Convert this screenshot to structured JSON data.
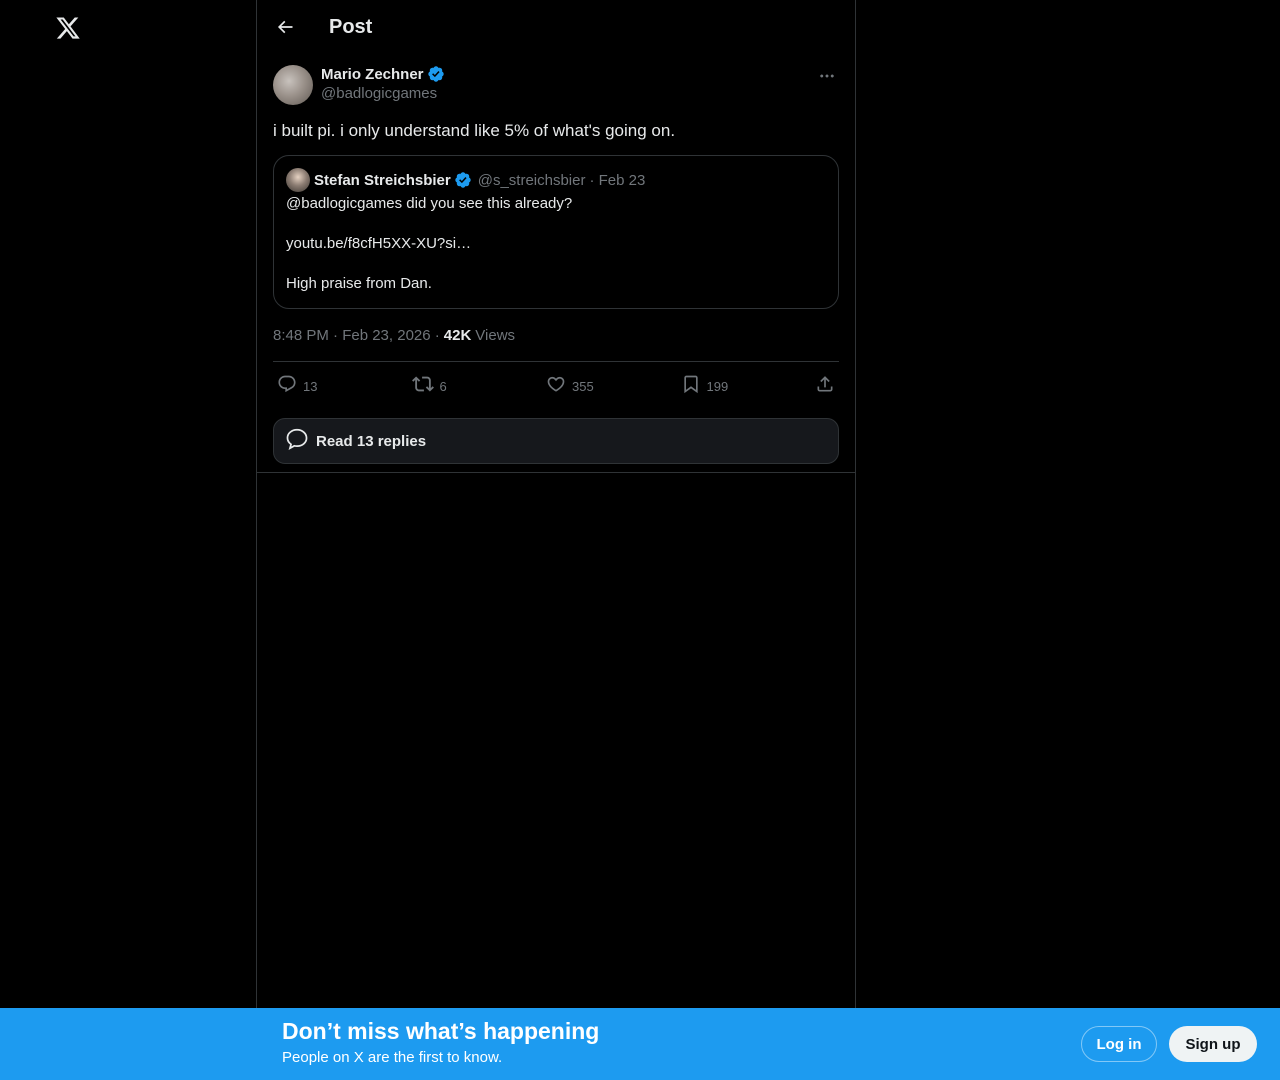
{
  "header": {
    "title": "Post"
  },
  "post": {
    "author": {
      "display_name": "Mario Zechner",
      "handle": "@badlogicgames",
      "verified": true
    },
    "text": "i built pi. i only understand like 5% of what's going on.",
    "quote": {
      "author": {
        "display_name": "Stefan Streichsbier",
        "handle": "@s_streichsbier",
        "verified": true
      },
      "date": "· Feb 23",
      "lines": [
        "@badlogicgames did you see this already?",
        "youtu.be/f8cfH5XX-XU?si…",
        "High praise from Dan."
      ]
    },
    "timestamp": "8:48 PM · Feb 23, 2026 ·",
    "views_count": "42K",
    "views_label": "Views",
    "actions": {
      "replies": "13",
      "reposts": "6",
      "likes": "355",
      "bookmarks": "199"
    },
    "read_replies_label": "Read 13 replies"
  },
  "banner": {
    "title": "Don’t miss what’s happening",
    "subtitle": "People on X are the first to know.",
    "login_label": "Log in",
    "signup_label": "Sign up"
  },
  "colors": {
    "background": "#000000",
    "accent": "#1d9bf0",
    "text_primary": "#e7e9ea",
    "text_secondary": "#71767b",
    "border": "#2f3336"
  },
  "icons": [
    "x-logo-icon",
    "back-arrow-icon",
    "verified-badge-icon",
    "more-icon",
    "reply-icon",
    "repost-icon",
    "like-icon",
    "bookmark-icon",
    "share-icon",
    "replies-bubble-icon"
  ]
}
